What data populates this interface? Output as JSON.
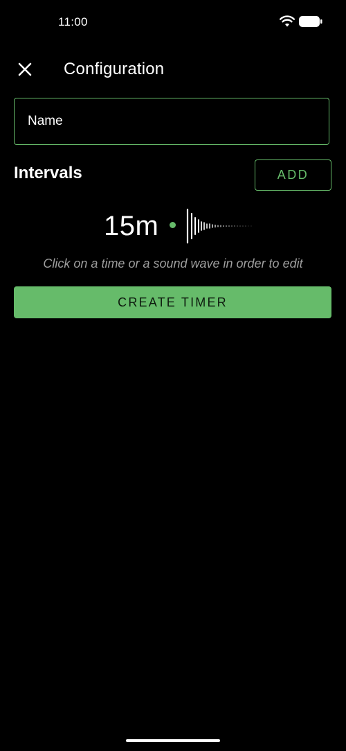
{
  "status_bar": {
    "time": "11:00",
    "icons": [
      "wifi-icon",
      "battery-icon"
    ]
  },
  "top_bar": {
    "close_icon": "close-icon",
    "title": "Configuration"
  },
  "name_field": {
    "placeholder": "Name",
    "value": ""
  },
  "intervals": {
    "title": "Intervals",
    "add_label": "ADD",
    "items": [
      {
        "time": "15m",
        "sound_icon": "sound-wave-icon"
      }
    ],
    "hint": "Click on a time or a sound wave in order to edit"
  },
  "create_label": "CREATE TIMER",
  "colors": {
    "accent": "#66bb6a",
    "background": "#000000",
    "text": "#ffffff",
    "hint": "#9e9e9e"
  }
}
